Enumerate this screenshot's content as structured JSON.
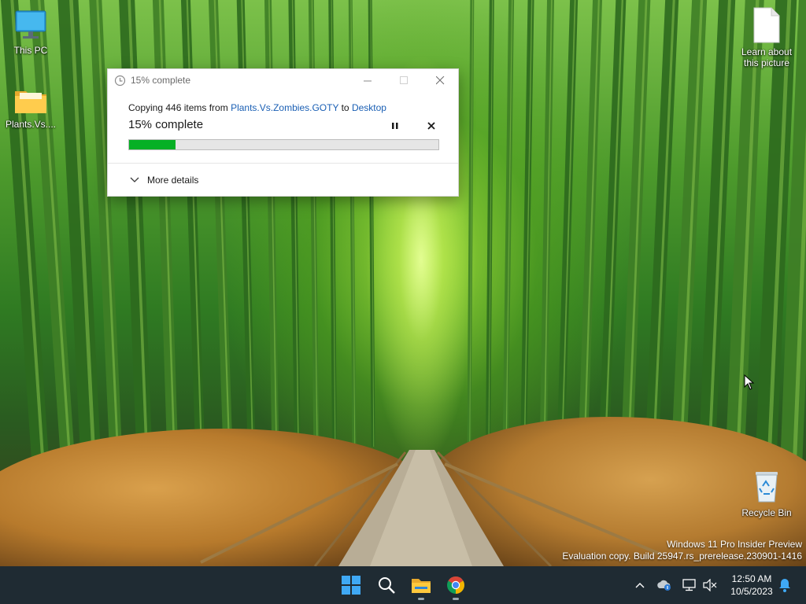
{
  "desktop": {
    "icons": [
      {
        "label": "This PC",
        "icon": "computer-icon"
      },
      {
        "label": "Plants.Vs....",
        "icon": "folder-icon"
      },
      {
        "label": "Learn about this picture",
        "icon": "document-icon"
      },
      {
        "label": "Recycle Bin",
        "icon": "recycle-bin-icon"
      }
    ],
    "watermark": {
      "line1": "Windows 11 Pro Insider Preview",
      "line2": "Evaluation copy. Build 25947.rs_prerelease.230901-1416"
    }
  },
  "dialog": {
    "title": "15% complete",
    "copy_prefix": "Copying 446 items from",
    "source": "Plants.Vs.Zombies.GOTY",
    "copy_to": "to",
    "destination": "Desktop",
    "progress_text": "15% complete",
    "progress_percent": 15,
    "more_details": "More details",
    "accent": "#06b025"
  },
  "taskbar": {
    "apps": [
      "start-icon",
      "search-icon",
      "file-explorer-icon",
      "chrome-icon"
    ],
    "tray": [
      "chevron-up-icon",
      "onedrive-icon",
      "network-icon",
      "volume-muted-icon"
    ],
    "time": "12:50 AM",
    "date": "10/5/2023"
  }
}
